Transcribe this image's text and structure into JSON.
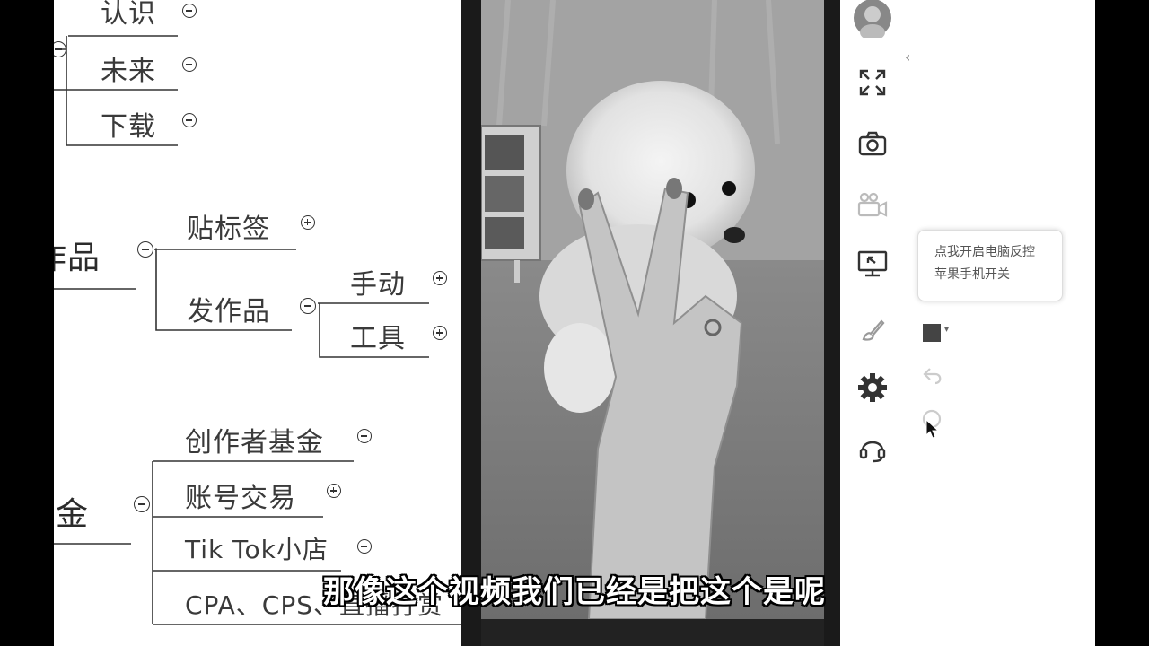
{
  "mindmap": {
    "top_nodes": [
      {
        "label": "认识"
      },
      {
        "label": "未来"
      },
      {
        "label": "下载"
      }
    ],
    "works_branch": {
      "label": "作品",
      "children": [
        {
          "label": "贴标签"
        },
        {
          "label": "发作品",
          "children": [
            {
              "label": "手动"
            },
            {
              "label": "工具"
            }
          ]
        }
      ]
    },
    "money_branch": {
      "label": "金",
      "children": [
        {
          "label": "创作者基金"
        },
        {
          "label": "账号交易"
        },
        {
          "label": "Tik Tok小店"
        },
        {
          "label": "CPA、CPS、直播打赏"
        }
      ]
    }
  },
  "toolbar": {
    "tools": [
      {
        "name": "avatar"
      },
      {
        "name": "fullscreen-icon"
      },
      {
        "name": "camera-icon"
      },
      {
        "name": "video-camera-icon"
      },
      {
        "name": "screen-control-icon"
      },
      {
        "name": "brush-icon"
      },
      {
        "name": "settings-icon"
      },
      {
        "name": "headset-icon"
      }
    ],
    "tooltip_line1": "点我开启电脑反控",
    "tooltip_line2": "苹果手机开关",
    "color_swatch": "#444444"
  },
  "subtitle": "那像这个视频我们已经是把这个是呢"
}
